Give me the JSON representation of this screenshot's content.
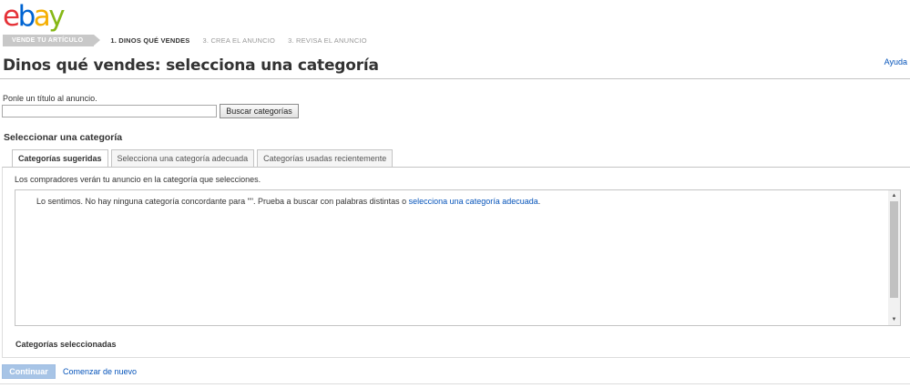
{
  "logo": {
    "e": "e",
    "b": "b",
    "a": "a",
    "y": "y"
  },
  "steps": {
    "first": "VENDE TU ARTÍCULO",
    "step1": "1. DINOS QUÉ VENDES",
    "step2": "3. CREA EL ANUNCIO",
    "step3": "3. REVISA EL ANUNCIO"
  },
  "page": {
    "title": "Dinos qué vendes: selecciona una categoría",
    "help": "Ayuda"
  },
  "title_field": {
    "label": "Ponle un título al anuncio.",
    "value": "",
    "search_button": "Buscar categorías"
  },
  "category": {
    "heading": "Seleccionar una categoría",
    "tabs": [
      {
        "label": "Categorías sugeridas"
      },
      {
        "label": "Selecciona una categoría adecuada"
      },
      {
        "label": "Categorías usadas recientemente"
      }
    ],
    "description": "Los compradores verán tu anuncio en la categoría que selecciones.",
    "no_results_text": "Lo sentimos. No hay ninguna categoría concordante para \"\". Prueba a buscar con palabras distintas o ",
    "no_results_link": "selecciona una categoría adecuada",
    "no_results_end": ".",
    "selected_heading": "Categorías seleccionadas"
  },
  "footer": {
    "continue": "Continuar",
    "restart": "Comenzar de nuevo"
  },
  "colors": {
    "ebay_red": "#e53238",
    "ebay_blue": "#0064d2",
    "ebay_yellow": "#f5af02",
    "ebay_green": "#86b817",
    "link": "#0654ba",
    "disabled_button": "#a7c4e6"
  }
}
